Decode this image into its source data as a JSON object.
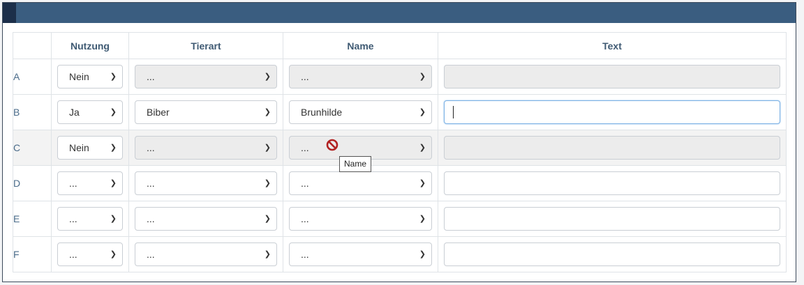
{
  "headers": {
    "nutzung": "Nutzung",
    "tierart": "Tierart",
    "name": "Name",
    "text": "Text"
  },
  "rows": [
    {
      "label": "A",
      "nutzung": "Nein",
      "tierart": "...",
      "name": "...",
      "text": ""
    },
    {
      "label": "B",
      "nutzung": "Ja",
      "tierart": "Biber",
      "name": "Brunhilde",
      "text": ""
    },
    {
      "label": "C",
      "nutzung": "Nein",
      "tierart": "...",
      "name": "...",
      "text": ""
    },
    {
      "label": "D",
      "nutzung": "...",
      "tierart": "...",
      "name": "...",
      "text": ""
    },
    {
      "label": "E",
      "nutzung": "...",
      "tierart": "...",
      "name": "...",
      "text": ""
    },
    {
      "label": "F",
      "nutzung": "...",
      "tierart": "...",
      "name": "...",
      "text": ""
    }
  ],
  "tooltip": "Name",
  "colors": {
    "header": "#3a5d80",
    "header_accent": "#1c2f4a",
    "label": "#4a6b8a",
    "not_allowed": "#b22222"
  }
}
